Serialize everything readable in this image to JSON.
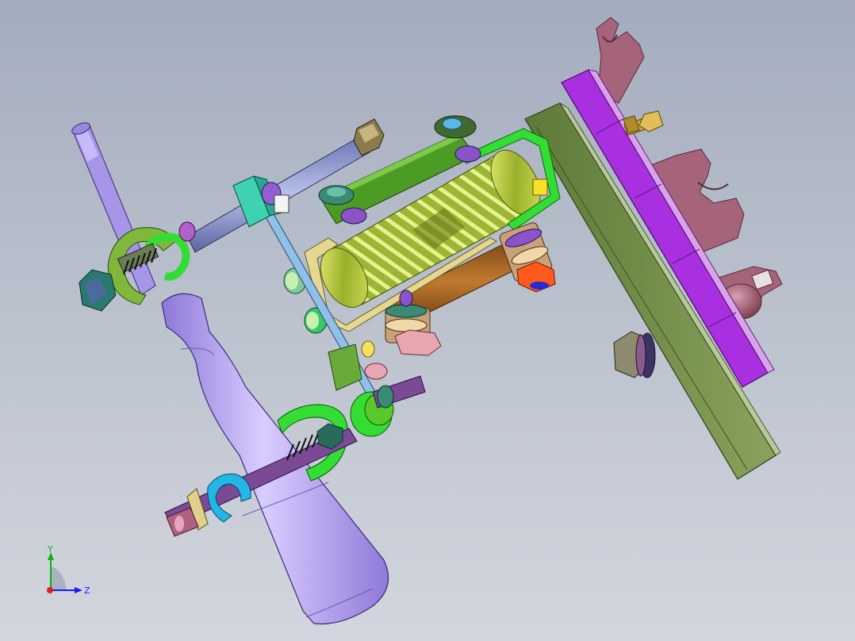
{
  "viewport": {
    "background_top": "#a3acbe",
    "background_bottom": "#d3d6de"
  },
  "triad": {
    "y_label": "Y",
    "z_label": "Z",
    "x_color": "#e02020",
    "y_color": "#10b010",
    "z_color": "#1a1aff"
  },
  "parts": {
    "bottle": "#b7a2f0",
    "rod": "#8a95c9",
    "top_bolt": "#8a95c9",
    "clamp_ring": "#7fb83a",
    "bright_ring": "#33dd33",
    "cyan_clip": "#22b7e6",
    "shaft_purple": "#7a4a95",
    "roller_frame": "#e4e08a",
    "roller": "#c2d23e",
    "link_green": "#4c9b25",
    "link_brown": "#9a5a1c",
    "plate_olive": "#6f8b48",
    "plate_purple": "#a830e0",
    "bracket_mauve": "#a5647a",
    "brass_nut": "#c9a43a",
    "orange_nut": "#ff5a1e",
    "pink_nut": "#e8a6b0",
    "teal_block": "#3fd2b0"
  }
}
